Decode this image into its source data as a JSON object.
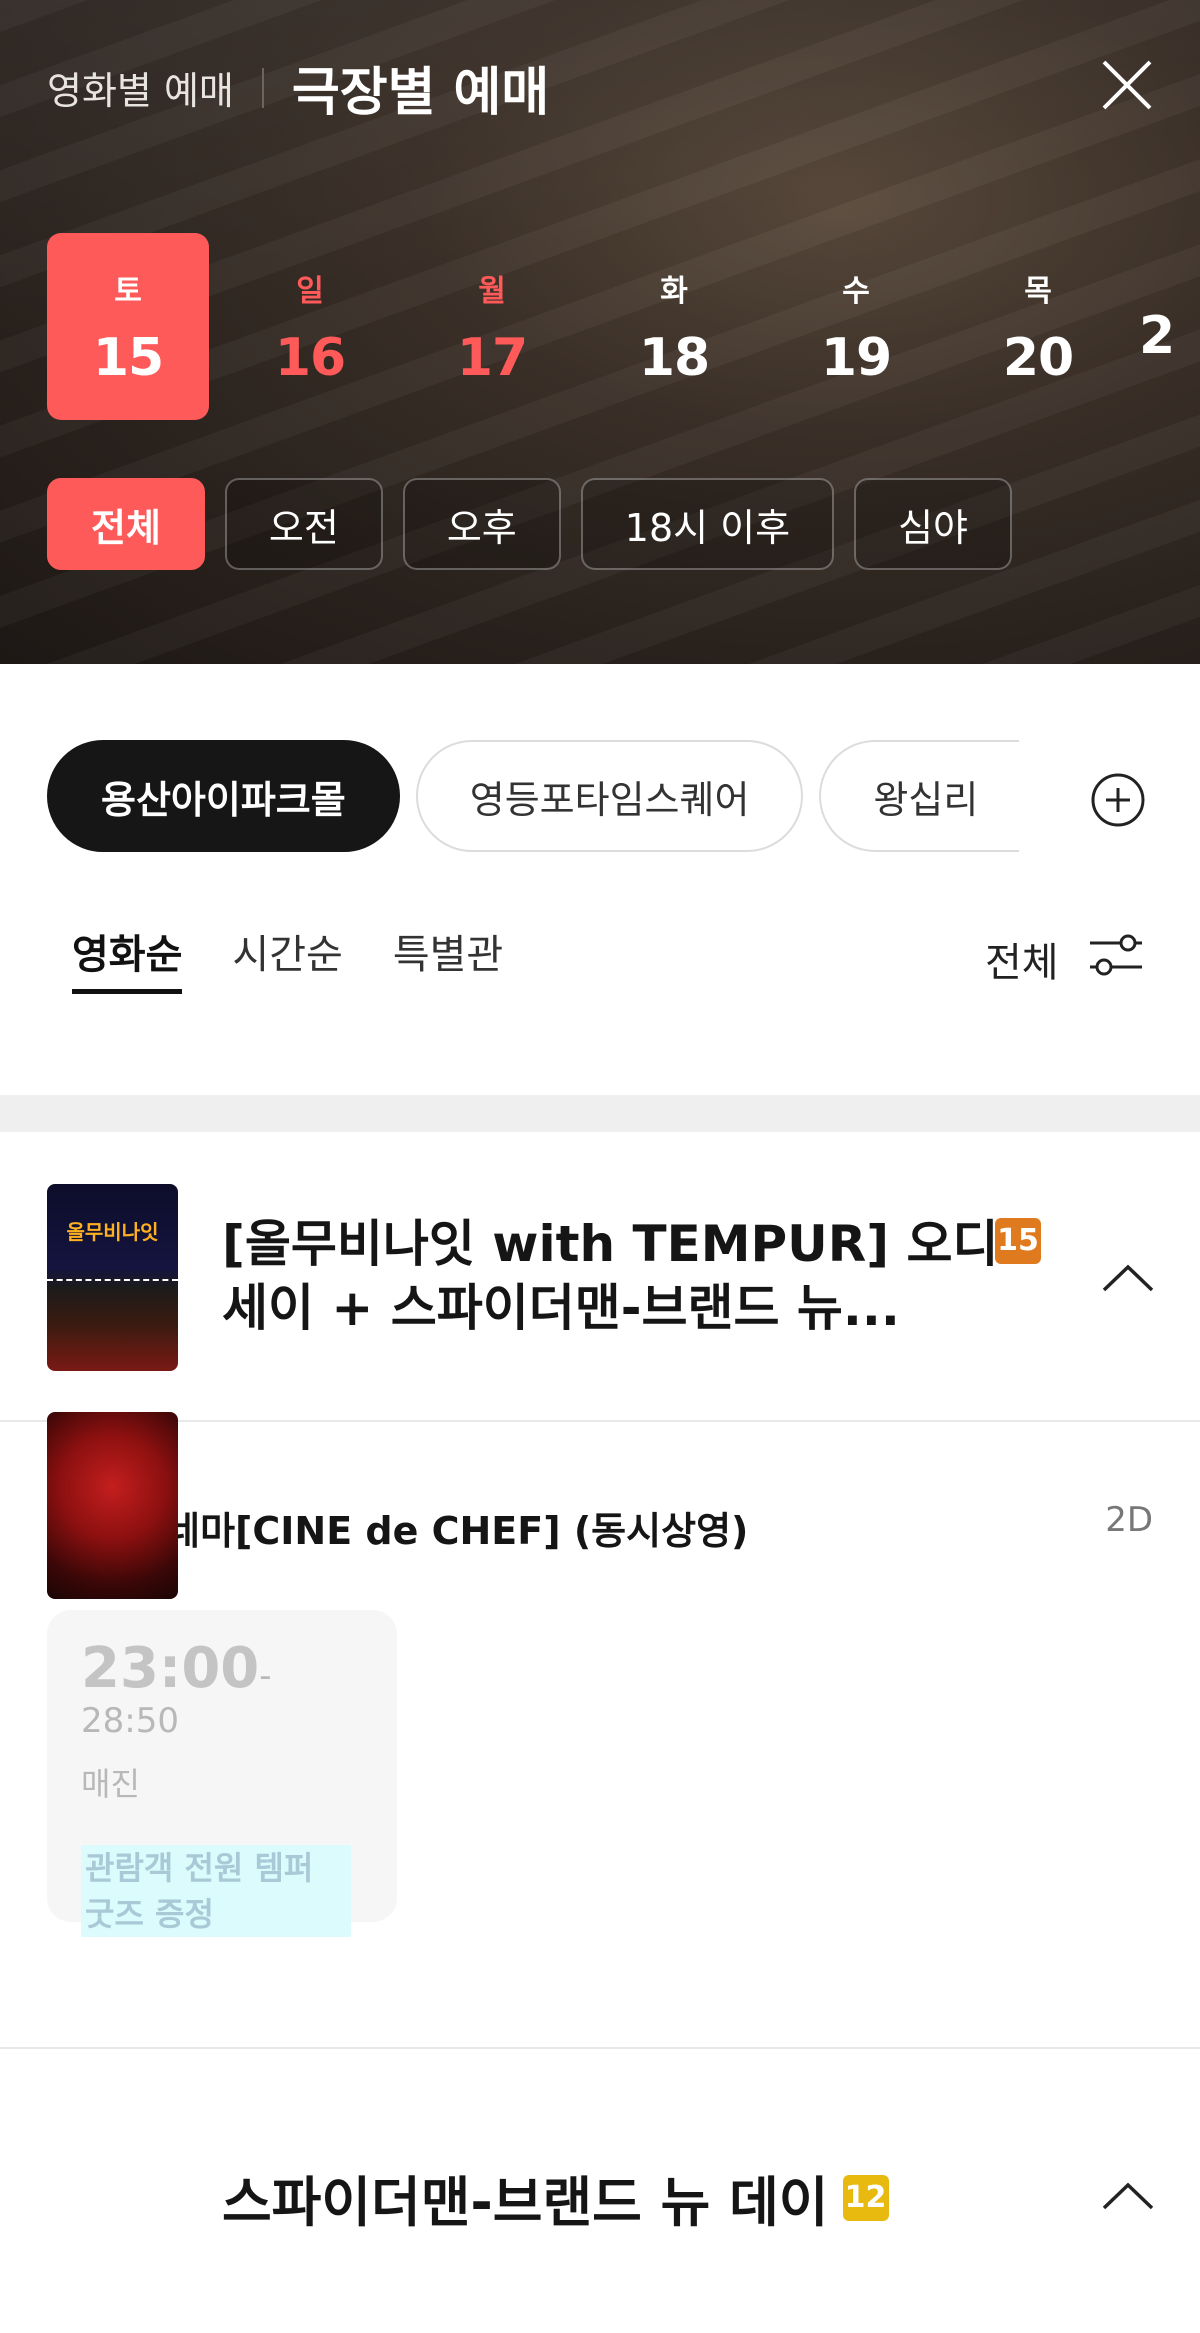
{
  "header": {
    "tab_movie": "영화별 예매",
    "tab_theater": "극장별 예매",
    "close_icon": "close-icon"
  },
  "dates": [
    {
      "dow": "토",
      "num": "15",
      "selected": true
    },
    {
      "dow": "일",
      "num": "16",
      "holiday": true
    },
    {
      "dow": "월",
      "num": "17",
      "holiday": true
    },
    {
      "dow": "화",
      "num": "18"
    },
    {
      "dow": "수",
      "num": "19"
    },
    {
      "dow": "목",
      "num": "20"
    },
    {
      "dow": "",
      "num": "2"
    }
  ],
  "time_filters": [
    "전체",
    "오전",
    "오후",
    "18시 이후",
    "심야"
  ],
  "theaters": [
    "용산아이파크몰",
    "영등포타임스퀘어",
    "왕십리"
  ],
  "sort_tabs": [
    "영화순",
    "시간순",
    "특별관"
  ],
  "filter": {
    "label": "전체"
  },
  "movies": [
    {
      "title": "[올무비나잇 with TEMPUR] 오디세이 + 스파이더맨-브랜드 뉴...",
      "rating": "15",
      "poster_text": "올무비나잇",
      "screen": {
        "name": "템퍼 시네마[CINE de CHEF] (동시상영)",
        "format": "2D"
      },
      "showtime": {
        "start": "23:00",
        "end": "- 28:50",
        "status": "매진",
        "note": "관람객 전원 템퍼 굿즈 증정"
      }
    },
    {
      "title": "스파이더맨-브랜드 뉴 데이",
      "rating": "12"
    }
  ],
  "colors": {
    "accent": "#ff5a5a",
    "rating15": "#e07a1f",
    "rating12": "#e8b90f"
  }
}
